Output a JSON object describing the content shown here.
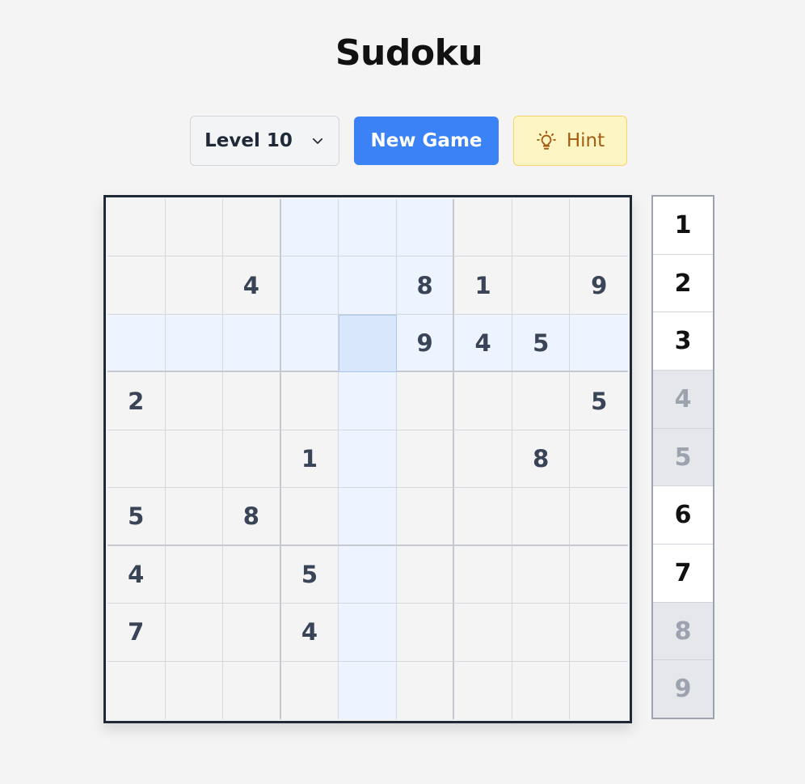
{
  "title": "Sudoku",
  "controls": {
    "level_label": "Level 10",
    "new_game_label": "New Game",
    "hint_label": "Hint"
  },
  "board": {
    "selected": {
      "row": 3,
      "col": 5
    },
    "cells": [
      [
        "",
        "",
        "",
        "",
        "",
        "",
        "",
        "",
        ""
      ],
      [
        "",
        "",
        "4",
        "",
        "",
        "8",
        "1",
        "",
        "9"
      ],
      [
        "",
        "",
        "",
        "",
        "",
        "9",
        "4",
        "5",
        ""
      ],
      [
        "2",
        "",
        "",
        "",
        "",
        "",
        "",
        "",
        "5"
      ],
      [
        "",
        "",
        "",
        "1",
        "",
        "",
        "",
        "8",
        ""
      ],
      [
        "5",
        "",
        "8",
        "",
        "",
        "",
        "",
        "",
        ""
      ],
      [
        "4",
        "",
        "",
        "5",
        "",
        "",
        "",
        "",
        ""
      ],
      [
        "7",
        "",
        "",
        "4",
        "",
        "",
        "",
        "",
        ""
      ],
      [
        "",
        "",
        "",
        "",
        "",
        "",
        "",
        "",
        ""
      ]
    ]
  },
  "numpad": [
    {
      "label": "1",
      "completed": false
    },
    {
      "label": "2",
      "completed": false
    },
    {
      "label": "3",
      "completed": false
    },
    {
      "label": "4",
      "completed": true
    },
    {
      "label": "5",
      "completed": true
    },
    {
      "label": "6",
      "completed": false
    },
    {
      "label": "7",
      "completed": false
    },
    {
      "label": "8",
      "completed": true
    },
    {
      "label": "9",
      "completed": true
    }
  ],
  "colors": {
    "accent": "#3b82f6",
    "highlight": "#edf4ff",
    "selected": "#d9e7fc",
    "hint_bg": "#fef5c4"
  },
  "icons": {
    "level_dropdown": "chevron-down-icon",
    "hint": "lightbulb-icon"
  }
}
